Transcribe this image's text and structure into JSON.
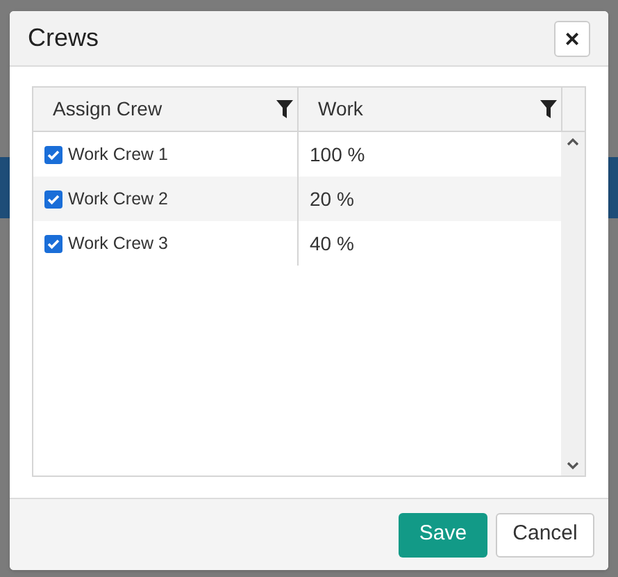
{
  "dialog": {
    "title": "Crews",
    "close_label": "×"
  },
  "grid": {
    "columns": [
      {
        "label": "Assign Crew"
      },
      {
        "label": "Work"
      }
    ],
    "rows": [
      {
        "crew": "Work Crew 1",
        "checked": true,
        "work": "100 %"
      },
      {
        "crew": "Work Crew 2",
        "checked": true,
        "work": "20 %"
      },
      {
        "crew": "Work Crew 3",
        "checked": true,
        "work": "40 %"
      }
    ]
  },
  "buttons": [
    {
      "label": "Save",
      "kind": "primary"
    },
    {
      "label": "Cancel",
      "kind": "secondary"
    }
  ]
}
